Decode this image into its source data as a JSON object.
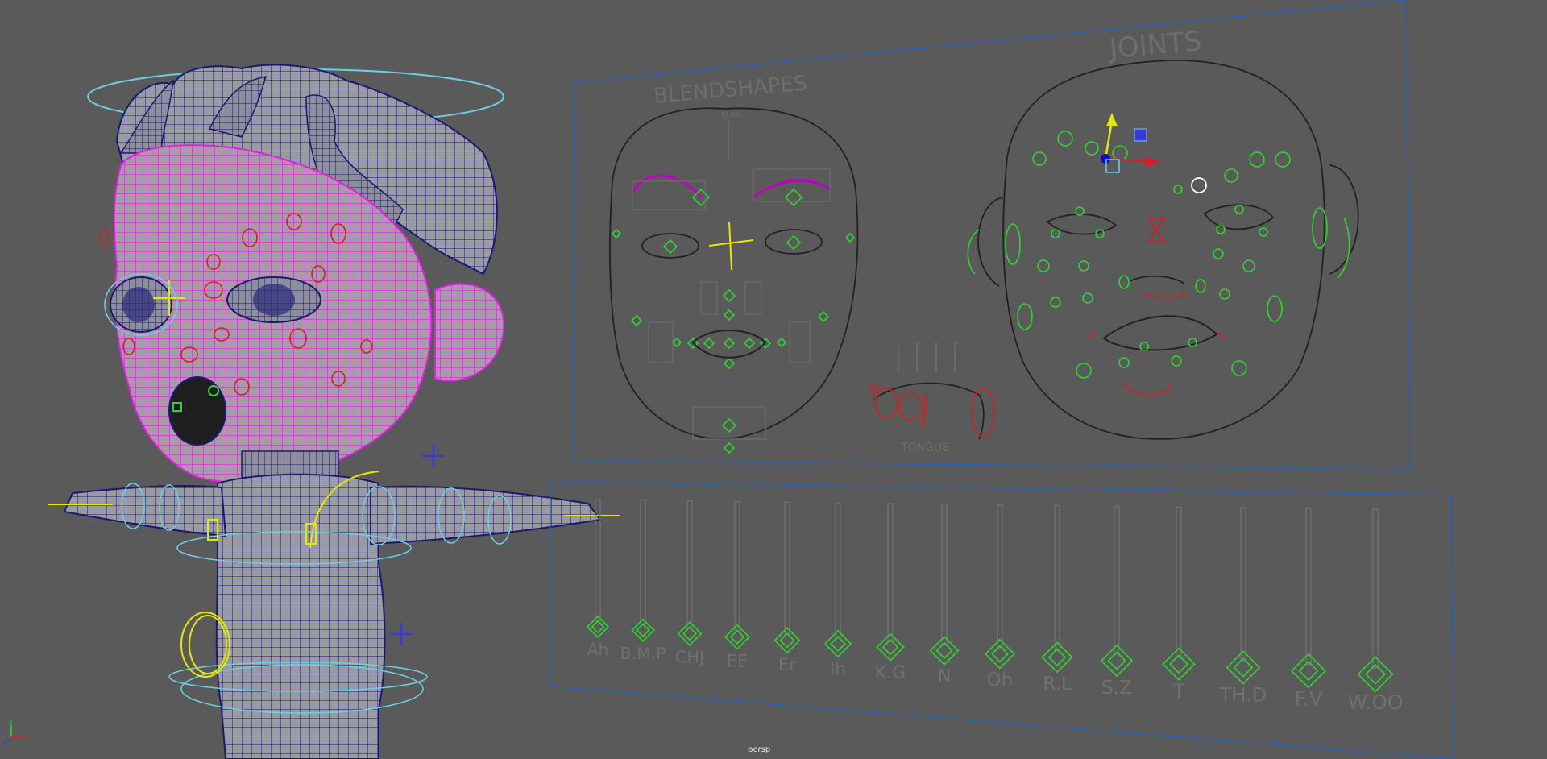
{
  "viewport": {
    "camera_name": "persp",
    "panel_titles": {
      "blendshapes": "BLENDSHAPES",
      "joints": "JOINTS",
      "tongue": "TONGUE",
      "blink": "BLINK"
    },
    "phonemes": [
      "Ah",
      "B.M.P",
      "CHJ",
      "EE",
      "Er",
      "Ih",
      "K.G",
      "N",
      "Oh",
      "R.L",
      "S.Z",
      "T",
      "TH.D",
      "F.V",
      "W.OO"
    ],
    "colors": {
      "background": "#5a5a5a",
      "wireframe_selected": "#e020e0",
      "wireframe": "#1a1a6e",
      "control_green": "#2fd42f",
      "control_red": "#d42020",
      "control_yellow": "#e6e600",
      "control_cyan": "#6ad0e8",
      "panel_border": "#2a5fb0"
    }
  },
  "gizmo": {
    "axes": [
      "x",
      "y",
      "z"
    ]
  }
}
